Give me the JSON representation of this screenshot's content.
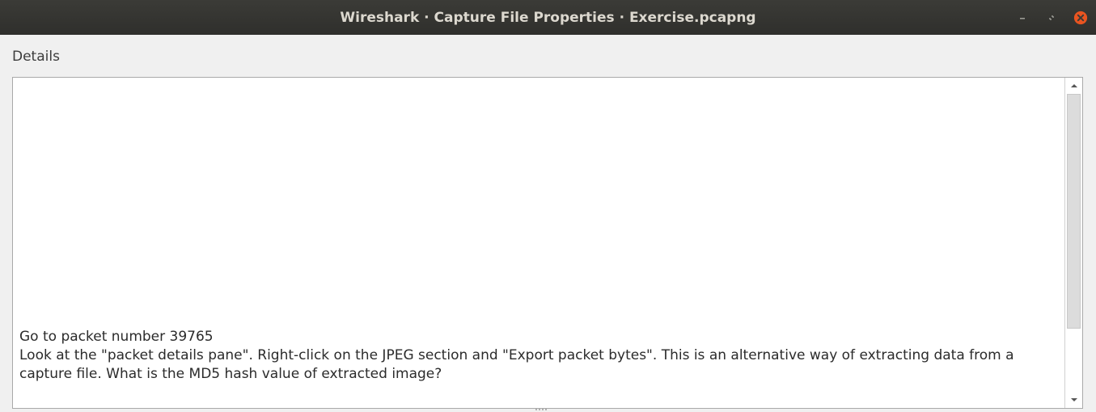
{
  "window": {
    "title": "Wireshark · Capture File Properties · Exercise.pcapng"
  },
  "controls": {
    "minimize_icon": "minimize-icon",
    "restore_icon": "restore-icon",
    "close_icon": "close-icon",
    "close_color": "#e95420"
  },
  "details": {
    "label": "Details",
    "text": "Go to packet number 39765\nLook at the \"packet details pane\". Right-click on the JPEG section and \"Export packet bytes\". This is an alternative way of extracting data from a capture file. What is the MD5 hash value of extracted image?"
  }
}
